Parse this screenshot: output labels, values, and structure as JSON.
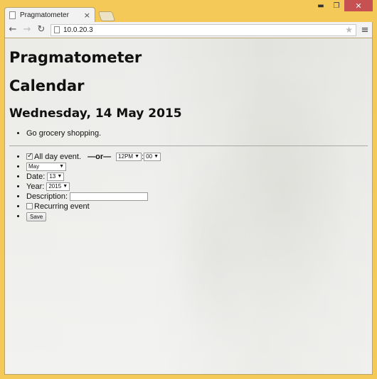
{
  "browser": {
    "tab_title": "Pragmatometer",
    "tab_close": "×",
    "url": "10.0.20.3",
    "window_controls": {
      "minimize": "▬",
      "maximize": "❐",
      "close": "✕"
    },
    "nav": {
      "back": "←",
      "forward": "→",
      "reload": "↻",
      "star": "★",
      "menu": "≡"
    },
    "frame_color": "#f5c957"
  },
  "page": {
    "site_title": "Pragmatometer",
    "section_title": "Calendar",
    "date_heading": "Wednesday, 14 May 2015",
    "events": [
      "Go grocery shopping."
    ]
  },
  "form": {
    "all_day_checked": true,
    "all_day_label": "All day event.",
    "or_label": "—or—",
    "hour_value": "12PM",
    "time_separator": ":",
    "minute_value": "00",
    "month_value": "May",
    "date_label": "Date:",
    "date_value": "13",
    "year_label": "Year:",
    "year_value": "2015",
    "description_label": "Description:",
    "description_value": "",
    "recurring_checked": false,
    "recurring_label": "Recurring event",
    "save_label": "Save"
  }
}
